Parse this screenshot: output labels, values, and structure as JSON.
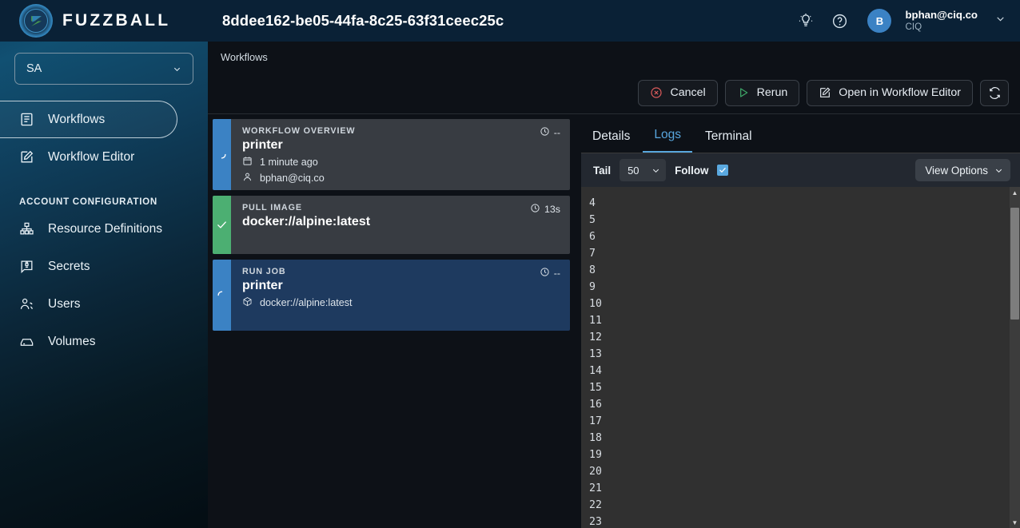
{
  "brand": {
    "name": "FUZZBALL",
    "logo_icon": "fuzzball-logo-icon"
  },
  "sidebar": {
    "account_select": {
      "value": "SA",
      "icon": "chevron-down-icon"
    },
    "items": [
      {
        "label": "Workflows",
        "icon": "list-icon",
        "active": true
      },
      {
        "label": "Workflow Editor",
        "icon": "edit-square-icon",
        "active": false
      }
    ],
    "section_label": "ACCOUNT CONFIGURATION",
    "config_items": [
      {
        "label": "Resource Definitions",
        "icon": "hierarchy-icon"
      },
      {
        "label": "Secrets",
        "icon": "secret-badge-icon"
      },
      {
        "label": "Users",
        "icon": "users-icon"
      },
      {
        "label": "Volumes",
        "icon": "drive-icon"
      }
    ]
  },
  "topbar": {
    "workflow_id": "8ddee162-be05-44fa-8c25-63f31ceec25c",
    "lightbulb_icon": "lightbulb-icon",
    "help_icon": "question-circle-icon",
    "avatar_initial": "B",
    "user_email": "bphan@ciq.co",
    "user_org": "CIQ",
    "user_chevron_icon": "chevron-down-icon"
  },
  "breadcrumb": {
    "text": "Workflows"
  },
  "actions": {
    "cancel": {
      "label": "Cancel",
      "icon": "cancel-circle-icon",
      "color": "#e05c5c"
    },
    "rerun": {
      "label": "Rerun",
      "icon": "play-triangle-icon",
      "color": "#3ea768"
    },
    "open_editor": {
      "label": "Open in Workflow Editor",
      "icon": "edit-square-icon"
    },
    "refresh": {
      "icon": "refresh-icon",
      "label": ""
    }
  },
  "cards": [
    {
      "kicker": "WORKFLOW OVERVIEW",
      "title": "printer",
      "duration": "--",
      "clock_icon": "clock-icon",
      "status_icon": "spinner-icon",
      "edge_color": "#3b82c4",
      "selected": false,
      "meta": [
        {
          "icon": "calendar-icon",
          "text": "1 minute ago"
        },
        {
          "icon": "person-icon",
          "text": "bphan@ciq.co"
        }
      ]
    },
    {
      "kicker": "PULL IMAGE",
      "title": "docker://alpine:latest",
      "duration": "13s",
      "clock_icon": "clock-icon",
      "status_icon": "check-icon",
      "edge_color": "#4caf72",
      "selected": false,
      "meta": []
    },
    {
      "kicker": "RUN JOB",
      "title": "printer",
      "duration": "--",
      "clock_icon": "clock-icon",
      "status_icon": "spinner-icon",
      "edge_color": "#3b82c4",
      "selected": true,
      "meta": [
        {
          "icon": "cube-icon",
          "text": "docker://alpine:latest"
        }
      ]
    }
  ],
  "tabs": [
    {
      "label": "Details",
      "active": false
    },
    {
      "label": "Logs",
      "active": true
    },
    {
      "label": "Terminal",
      "active": false
    }
  ],
  "logs_toolbar": {
    "tail_label": "Tail",
    "tail_value": "50",
    "tail_chevron_icon": "chevron-down-icon",
    "follow_label": "Follow",
    "follow_checked": true,
    "check_icon": "check-icon",
    "view_options_label": "View Options",
    "view_options_icon": "chevron-down-icon"
  },
  "log_lines": [
    "4",
    "5",
    "6",
    "7",
    "8",
    "9",
    "10",
    "11",
    "12",
    "13",
    "14",
    "15",
    "16",
    "17",
    "18",
    "19",
    "20",
    "21",
    "22",
    "23"
  ],
  "scrollbar": {
    "up_icon": "triangle-up-icon",
    "down_icon": "triangle-down-icon"
  },
  "colors": {
    "accent_blue": "#58a6dd",
    "sidebar_top": "#0a2136",
    "panel_bg": "#303030",
    "success_green": "#4caf72",
    "danger_red": "#e05c5c"
  }
}
